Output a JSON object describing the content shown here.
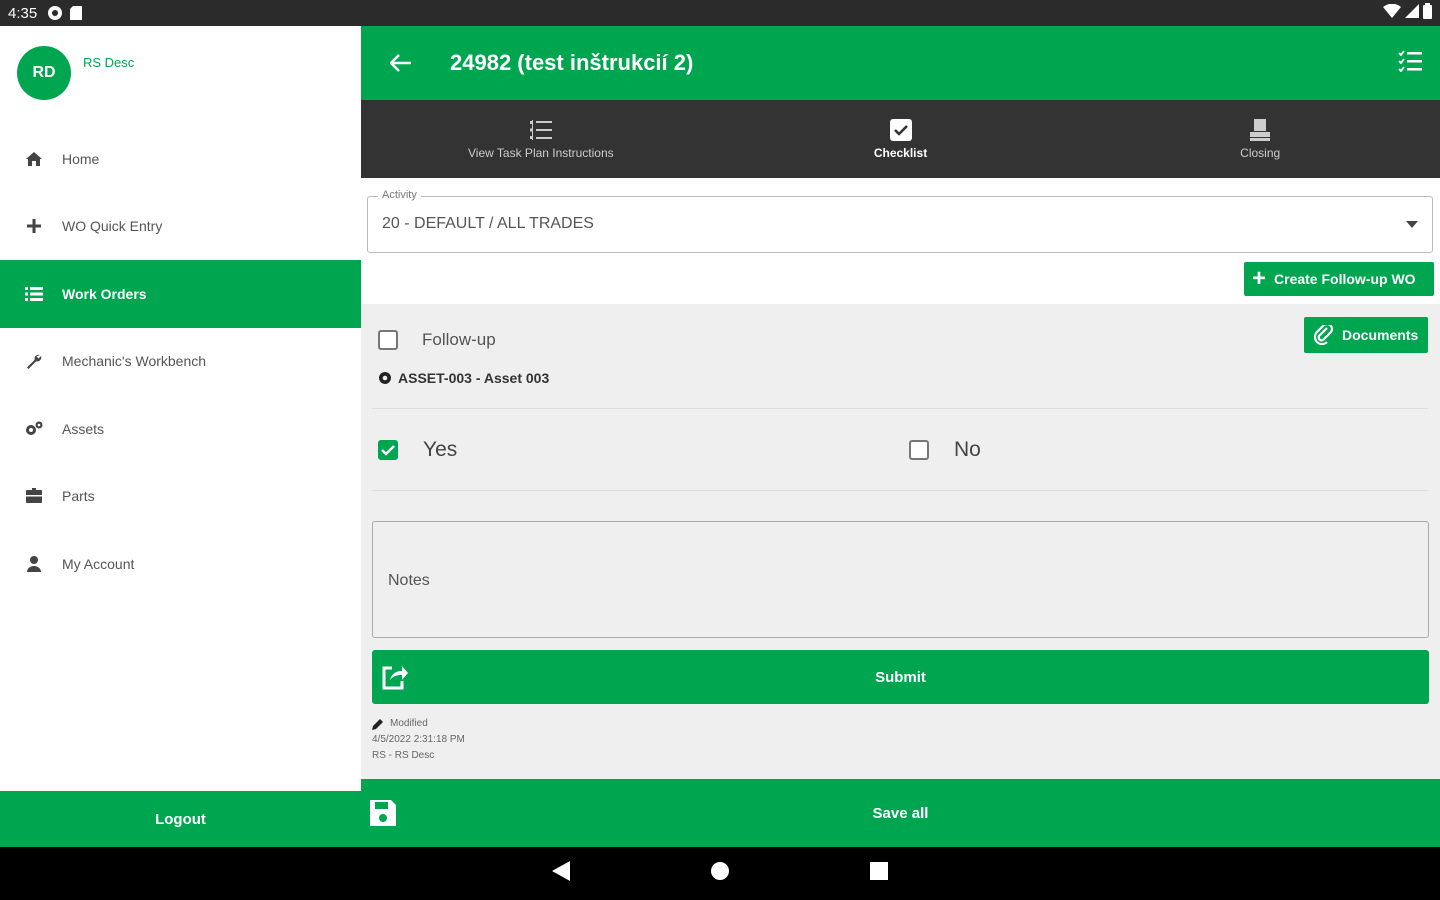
{
  "statusbar": {
    "time": "4:35"
  },
  "drawer": {
    "avatar_initials": "RD",
    "user_name": "RS Desc",
    "items": [
      {
        "label": "Home",
        "icon": "home-icon"
      },
      {
        "label": "WO Quick Entry",
        "icon": "plus-icon"
      },
      {
        "label": "Work Orders",
        "icon": "list-icon",
        "active": true
      },
      {
        "label": "Mechanic's Workbench",
        "icon": "wrench-icon"
      },
      {
        "label": "Assets",
        "icon": "gears-icon"
      },
      {
        "label": "Parts",
        "icon": "box-icon"
      },
      {
        "label": "My Account",
        "icon": "user-icon"
      }
    ],
    "logout_label": "Logout"
  },
  "appbar": {
    "title": "24982 (test inštrukcií 2)"
  },
  "tabs": [
    {
      "label": "View Task Plan Instructions",
      "icon": "list-icon"
    },
    {
      "label": "Checklist",
      "icon": "checkbox-icon",
      "active": true
    },
    {
      "label": "Closing",
      "icon": "stamp-icon"
    }
  ],
  "activity": {
    "label": "Activity",
    "value": "20 - DEFAULT / ALL TRADES"
  },
  "create_followup_label": "Create Follow-up WO",
  "followup_label": "Follow-up",
  "documents_label": "Documents",
  "asset_label": "ASSET-003 - Asset 003",
  "yes_label": "Yes",
  "no_label": "No",
  "notes_placeholder": "Notes",
  "submit_label": "Submit",
  "modified": {
    "title": "Modified",
    "date": "4/5/2022 2:31:18 PM",
    "user": "RS - RS Desc"
  },
  "save_all_label": "Save all",
  "colors": {
    "primary": "#00a550",
    "tabs_bg": "#333333"
  }
}
